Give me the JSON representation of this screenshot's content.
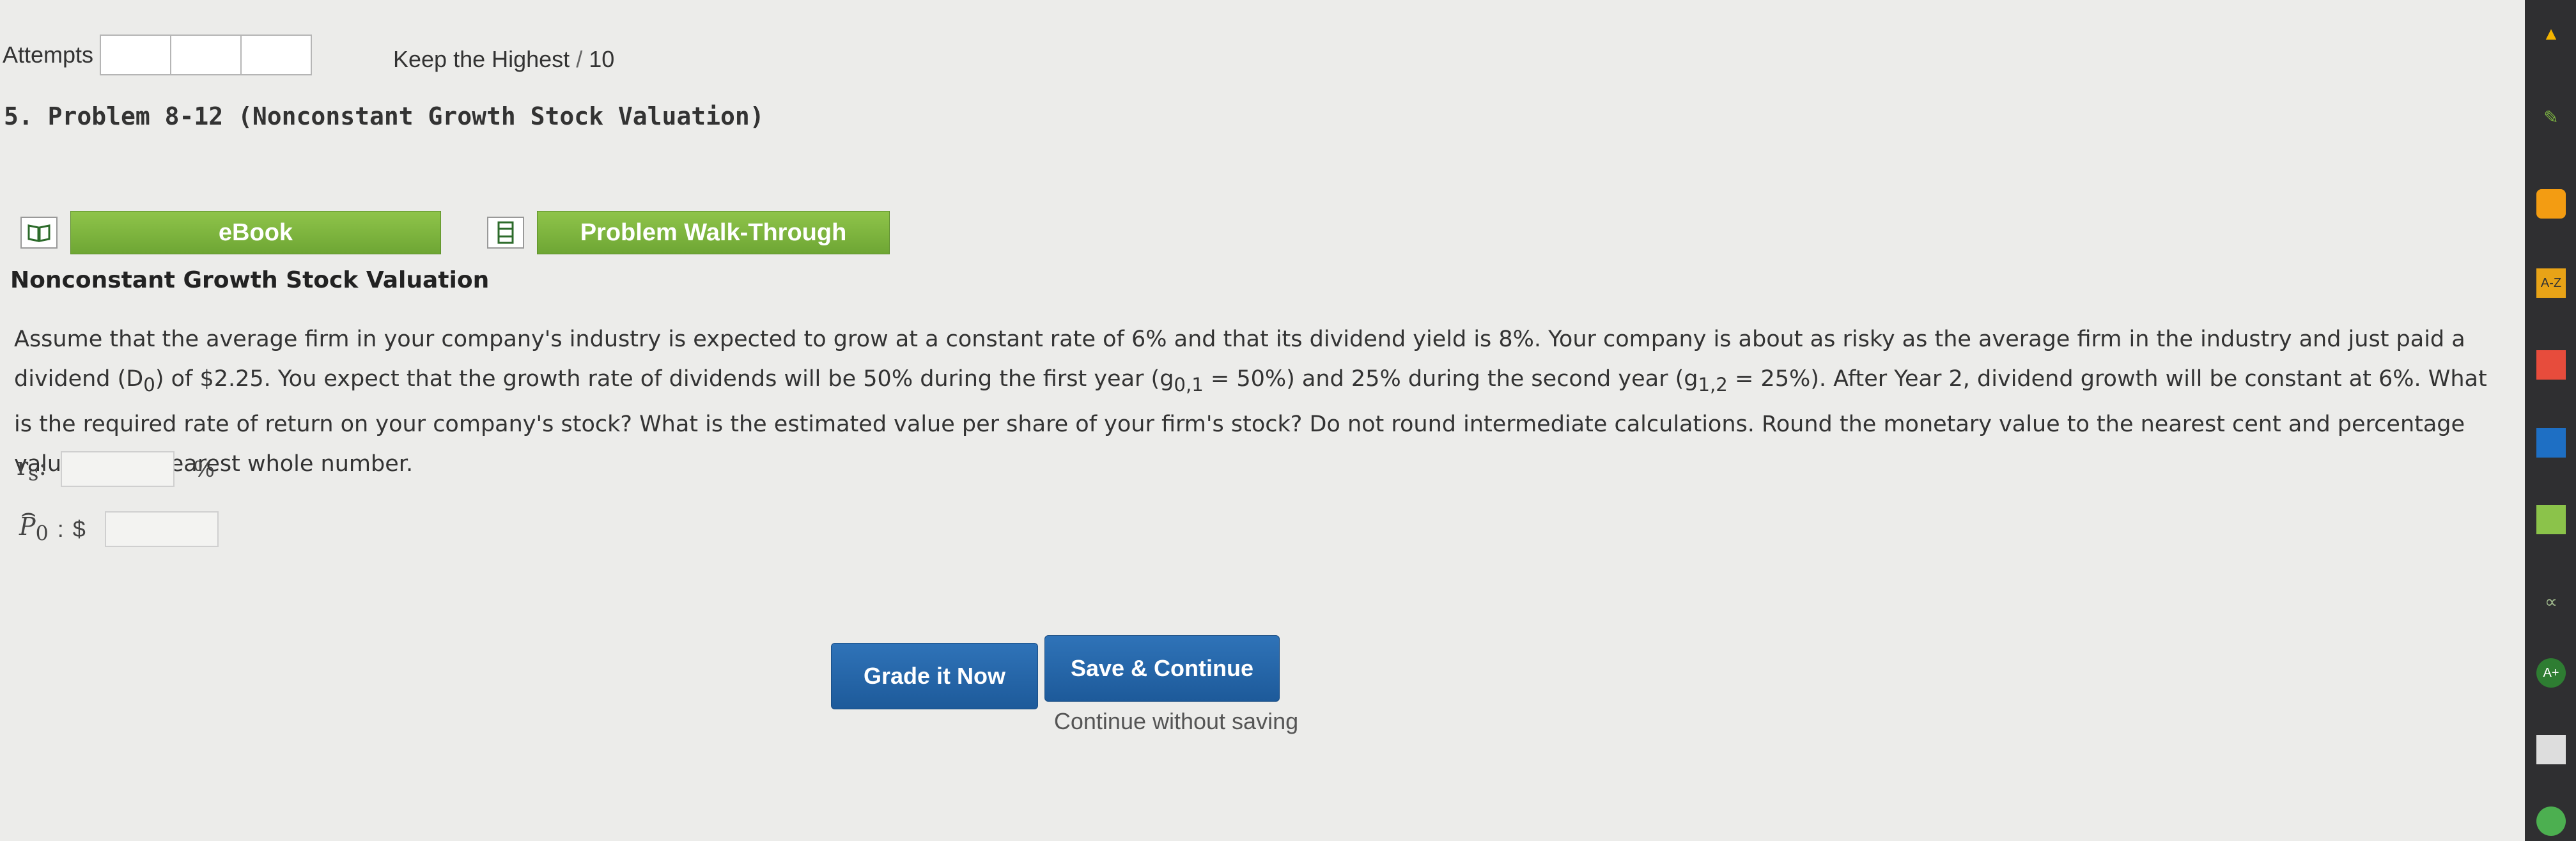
{
  "attempts": {
    "label": "Attempts",
    "count": 3
  },
  "keep": {
    "text": "Keep the Highest",
    "sep": "/",
    "value": "10"
  },
  "problem": {
    "title": "5. Problem 8-12 (Nonconstant Growth Stock Valuation)"
  },
  "resources": {
    "ebook": "eBook",
    "walkthrough": "Problem Walk-Through"
  },
  "section_title": "Nonconstant Growth Stock Valuation",
  "question": {
    "p1": "Assume that the average firm in your company's industry is expected to grow at a constant rate of 6% and that its dividend yield is 8%. Your company is about as risky as the average firm in the industry and just paid a dividend (D",
    "d0_sub": "0",
    "p2": ") of $2.25. You expect that the growth rate of dividends will be 50% during the first year (g",
    "g1_sub": "0,1",
    "p3": " = 50%) and 25% during the second year (g",
    "g2_sub": "1,2",
    "p4": " = 25%). After Year 2, dividend growth will be constant at 6%. What is the required rate of return on your company's stock? What is the estimated value per share of your firm's stock? Do not round intermediate calculations. Round the monetary value to the nearest cent and percentage value to the nearest whole number."
  },
  "answers": {
    "rs_label": "r",
    "rs_sub": "s",
    "rs_colon": ":",
    "rs_value": "",
    "rs_unit": "%",
    "p0_label": "P",
    "p0_sub": "0",
    "p0_colon": ":",
    "p0_currency": "$",
    "p0_value": ""
  },
  "buttons": {
    "grade": "Grade it Now",
    "save": "Save & Continue",
    "continue": "Continue without saving"
  },
  "sidebar_icons": [
    {
      "name": "drive-icon",
      "color": "#f4b400",
      "text": "▲"
    },
    {
      "name": "pen-icon",
      "color": "#7cb342",
      "text": "✎"
    },
    {
      "name": "rss-icon",
      "color": "#f39c12",
      "text": ""
    },
    {
      "name": "az-icon",
      "color": "#e8a317",
      "text": "A-Z"
    },
    {
      "name": "key-icon",
      "color": "#e74c3c",
      "text": ""
    },
    {
      "name": "book-icon",
      "color": "#1e6fc4",
      "text": ""
    },
    {
      "name": "highlighter-icon",
      "color": "#8bc34a",
      "text": ""
    },
    {
      "name": "audio-icon",
      "color": "#6d8c5a",
      "text": "∝"
    },
    {
      "name": "grade-icon",
      "color": "#2e7d32",
      "text": "A+"
    },
    {
      "name": "notes-icon",
      "color": "#dddddd",
      "text": ""
    },
    {
      "name": "extension-icon",
      "color": "#4caf50",
      "text": ""
    }
  ]
}
